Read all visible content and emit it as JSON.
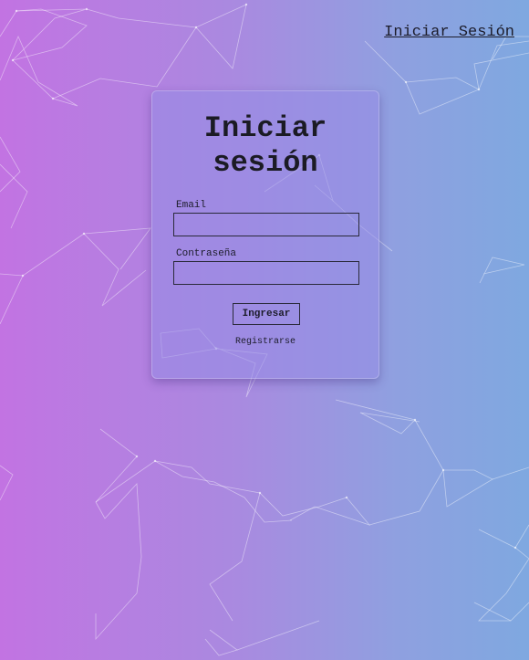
{
  "nav": {
    "login_link": "Iniciar Sesión"
  },
  "login_card": {
    "title": "Iniciar sesión",
    "email_label": "Email",
    "email_value": "",
    "password_label": "Contraseña",
    "password_value": "",
    "submit_label": "Ingresar",
    "register_label": "Registrarse"
  },
  "colors": {
    "gradient_left": "#c273e2",
    "gradient_right": "#7fa8e0",
    "network_line": "#ffffff"
  }
}
